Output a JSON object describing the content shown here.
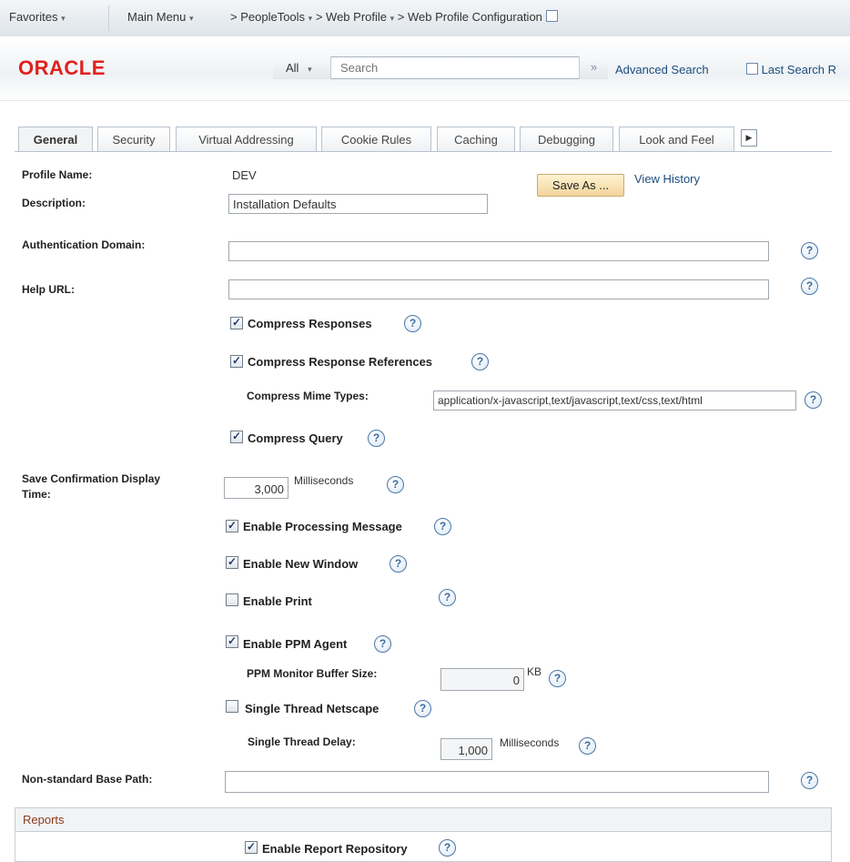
{
  "nav": {
    "favorites": "Favorites",
    "main_menu": "Main Menu",
    "crumbs": [
      {
        "sep": ">",
        "label": "PeopleTools"
      },
      {
        "sep": ">",
        "label": "Web Profile"
      },
      {
        "sep": ">",
        "label": "Web Profile Configuration"
      }
    ]
  },
  "search": {
    "logo": "ORACLE",
    "category": "All",
    "placeholder": "Search",
    "go": "»",
    "advanced": "Advanced Search",
    "last": "Last Search R"
  },
  "tabs": [
    {
      "label": "General",
      "active": true
    },
    {
      "label": "Security"
    },
    {
      "label": "Virtual Addressing"
    },
    {
      "label": "Cookie Rules"
    },
    {
      "label": "Caching"
    },
    {
      "label": "Debugging"
    },
    {
      "label": "Look and Feel"
    }
  ],
  "form": {
    "profile_name_label": "Profile Name:",
    "profile_name": "DEV",
    "save_as": "Save As ...",
    "view_history": "View History",
    "description_label": "Description:",
    "description": "Installation Defaults",
    "auth_domain_label": "Authentication Domain:",
    "auth_domain": "",
    "help_url_label": "Help URL:",
    "help_url": "",
    "compress_responses": {
      "label": "Compress Responses",
      "checked": true
    },
    "compress_response_refs": {
      "label": "Compress Response References",
      "checked": true
    },
    "compress_mime_label": "Compress Mime Types:",
    "compress_mime": "application/x-javascript,text/javascript,text/css,text/html",
    "compress_query": {
      "label": "Compress Query",
      "checked": true
    },
    "save_confirm_label_1": "Save Confirmation Display",
    "save_confirm_label_2": "Time:",
    "save_confirm": "3,000",
    "milliseconds": "Milliseconds",
    "enable_processing_message": {
      "label": "Enable Processing Message",
      "checked": true
    },
    "enable_new_window": {
      "label": "Enable New Window",
      "checked": true
    },
    "enable_print": {
      "label": "Enable Print",
      "checked": false
    },
    "enable_ppm_agent": {
      "label": "Enable PPM Agent",
      "checked": true
    },
    "ppm_buffer_label": "PPM Monitor Buffer Size:",
    "ppm_buffer": "0",
    "kb": "KB",
    "single_thread_netscape": {
      "label": "Single Thread Netscape",
      "checked": false
    },
    "single_thread_delay_label": "Single Thread Delay:",
    "single_thread_delay": "1,000",
    "non_standard_base_path_label": "Non-standard Base Path:",
    "non_standard_base_path": ""
  },
  "reports": {
    "title": "Reports",
    "enable_report_repository": {
      "label": "Enable Report Repository",
      "checked": true
    }
  },
  "icons": {
    "help": "?",
    "check": "✓",
    "caret": "▾",
    "more_tabs": "▶"
  }
}
